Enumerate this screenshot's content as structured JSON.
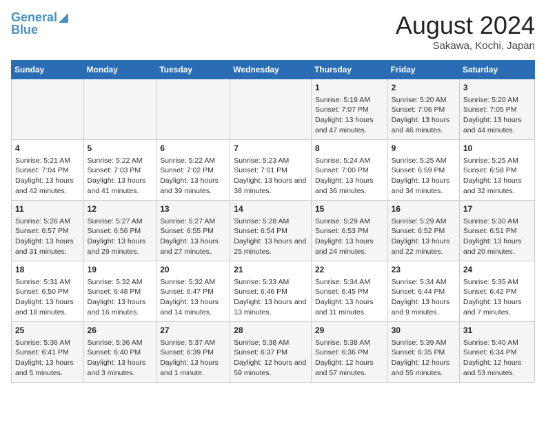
{
  "header": {
    "logo_line1": "General",
    "logo_line2": "Blue",
    "main_title": "August 2024",
    "subtitle": "Sakawa, Kochi, Japan"
  },
  "days_of_week": [
    "Sunday",
    "Monday",
    "Tuesday",
    "Wednesday",
    "Thursday",
    "Friday",
    "Saturday"
  ],
  "weeks": [
    {
      "cells": [
        {
          "day": "",
          "content": ""
        },
        {
          "day": "",
          "content": ""
        },
        {
          "day": "",
          "content": ""
        },
        {
          "day": "",
          "content": ""
        },
        {
          "day": "1",
          "content": "Sunrise: 5:19 AM\nSunset: 7:07 PM\nDaylight: 13 hours and 47 minutes."
        },
        {
          "day": "2",
          "content": "Sunrise: 5:20 AM\nSunset: 7:06 PM\nDaylight: 13 hours and 46 minutes."
        },
        {
          "day": "3",
          "content": "Sunrise: 5:20 AM\nSunset: 7:05 PM\nDaylight: 13 hours and 44 minutes."
        }
      ]
    },
    {
      "cells": [
        {
          "day": "4",
          "content": "Sunrise: 5:21 AM\nSunset: 7:04 PM\nDaylight: 13 hours and 42 minutes."
        },
        {
          "day": "5",
          "content": "Sunrise: 5:22 AM\nSunset: 7:03 PM\nDaylight: 13 hours and 41 minutes."
        },
        {
          "day": "6",
          "content": "Sunrise: 5:22 AM\nSunset: 7:02 PM\nDaylight: 13 hours and 39 minutes."
        },
        {
          "day": "7",
          "content": "Sunrise: 5:23 AM\nSunset: 7:01 PM\nDaylight: 13 hours and 38 minutes."
        },
        {
          "day": "8",
          "content": "Sunrise: 5:24 AM\nSunset: 7:00 PM\nDaylight: 13 hours and 36 minutes."
        },
        {
          "day": "9",
          "content": "Sunrise: 5:25 AM\nSunset: 6:59 PM\nDaylight: 13 hours and 34 minutes."
        },
        {
          "day": "10",
          "content": "Sunrise: 5:25 AM\nSunset: 6:58 PM\nDaylight: 13 hours and 32 minutes."
        }
      ]
    },
    {
      "cells": [
        {
          "day": "11",
          "content": "Sunrise: 5:26 AM\nSunset: 6:57 PM\nDaylight: 13 hours and 31 minutes."
        },
        {
          "day": "12",
          "content": "Sunrise: 5:27 AM\nSunset: 6:56 PM\nDaylight: 13 hours and 29 minutes."
        },
        {
          "day": "13",
          "content": "Sunrise: 5:27 AM\nSunset: 6:55 PM\nDaylight: 13 hours and 27 minutes."
        },
        {
          "day": "14",
          "content": "Sunrise: 5:28 AM\nSunset: 6:54 PM\nDaylight: 13 hours and 25 minutes."
        },
        {
          "day": "15",
          "content": "Sunrise: 5:29 AM\nSunset: 6:53 PM\nDaylight: 13 hours and 24 minutes."
        },
        {
          "day": "16",
          "content": "Sunrise: 5:29 AM\nSunset: 6:52 PM\nDaylight: 13 hours and 22 minutes."
        },
        {
          "day": "17",
          "content": "Sunrise: 5:30 AM\nSunset: 6:51 PM\nDaylight: 13 hours and 20 minutes."
        }
      ]
    },
    {
      "cells": [
        {
          "day": "18",
          "content": "Sunrise: 5:31 AM\nSunset: 6:50 PM\nDaylight: 13 hours and 18 minutes."
        },
        {
          "day": "19",
          "content": "Sunrise: 5:32 AM\nSunset: 6:48 PM\nDaylight: 13 hours and 16 minutes."
        },
        {
          "day": "20",
          "content": "Sunrise: 5:32 AM\nSunset: 6:47 PM\nDaylight: 13 hours and 14 minutes."
        },
        {
          "day": "21",
          "content": "Sunrise: 5:33 AM\nSunset: 6:46 PM\nDaylight: 13 hours and 13 minutes."
        },
        {
          "day": "22",
          "content": "Sunrise: 5:34 AM\nSunset: 6:45 PM\nDaylight: 13 hours and 11 minutes."
        },
        {
          "day": "23",
          "content": "Sunrise: 5:34 AM\nSunset: 6:44 PM\nDaylight: 13 hours and 9 minutes."
        },
        {
          "day": "24",
          "content": "Sunrise: 5:35 AM\nSunset: 6:42 PM\nDaylight: 13 hours and 7 minutes."
        }
      ]
    },
    {
      "cells": [
        {
          "day": "25",
          "content": "Sunrise: 5:36 AM\nSunset: 6:41 PM\nDaylight: 13 hours and 5 minutes."
        },
        {
          "day": "26",
          "content": "Sunrise: 5:36 AM\nSunset: 6:40 PM\nDaylight: 13 hours and 3 minutes."
        },
        {
          "day": "27",
          "content": "Sunrise: 5:37 AM\nSunset: 6:39 PM\nDaylight: 13 hours and 1 minute."
        },
        {
          "day": "28",
          "content": "Sunrise: 5:38 AM\nSunset: 6:37 PM\nDaylight: 12 hours and 59 minutes."
        },
        {
          "day": "29",
          "content": "Sunrise: 5:38 AM\nSunset: 6:36 PM\nDaylight: 12 hours and 57 minutes."
        },
        {
          "day": "30",
          "content": "Sunrise: 5:39 AM\nSunset: 6:35 PM\nDaylight: 12 hours and 55 minutes."
        },
        {
          "day": "31",
          "content": "Sunrise: 5:40 AM\nSunset: 6:34 PM\nDaylight: 12 hours and 53 minutes."
        }
      ]
    }
  ]
}
